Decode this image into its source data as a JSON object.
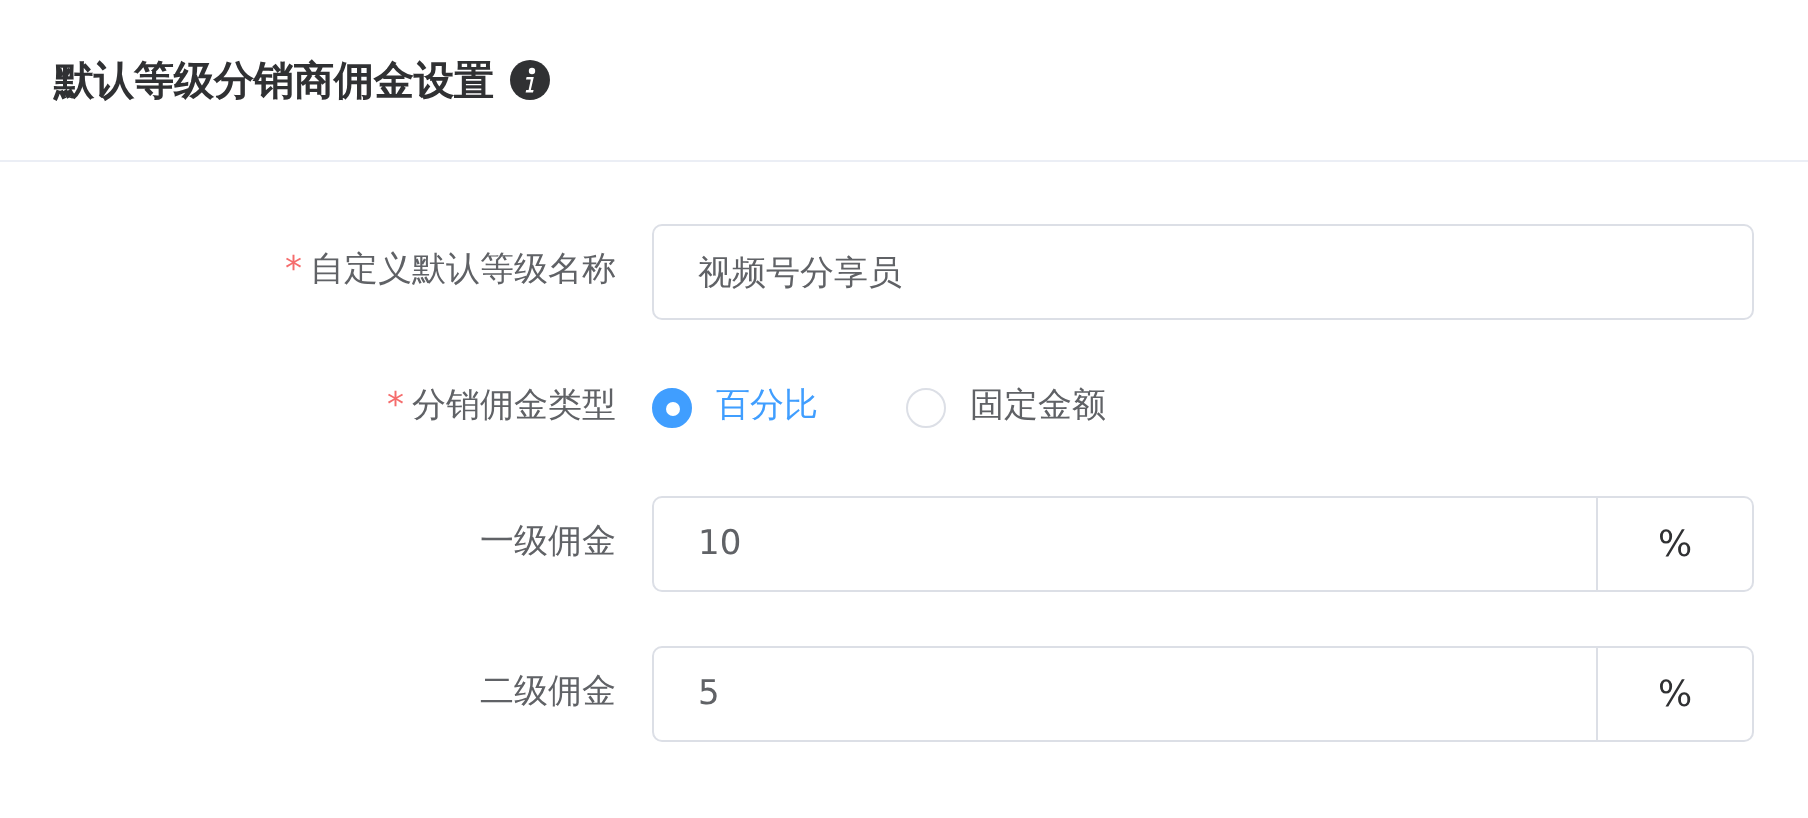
{
  "header": {
    "title": "默认等级分销商佣金设置"
  },
  "fields": [
    {
      "kind": "text",
      "label": "自定义默认等级名称",
      "required_mark": "*",
      "value": "视频号分享员"
    },
    {
      "kind": "radio",
      "label": "分销佣金类型",
      "required_mark": "*",
      "options": [
        {
          "label": "百分比",
          "selected": true
        },
        {
          "label": "固定金额",
          "selected": false
        }
      ]
    },
    {
      "kind": "suffix",
      "label": "一级佣金",
      "value": "10",
      "suffix": "%"
    },
    {
      "kind": "suffix",
      "label": "二级佣金",
      "value": "5",
      "suffix": "%"
    }
  ]
}
